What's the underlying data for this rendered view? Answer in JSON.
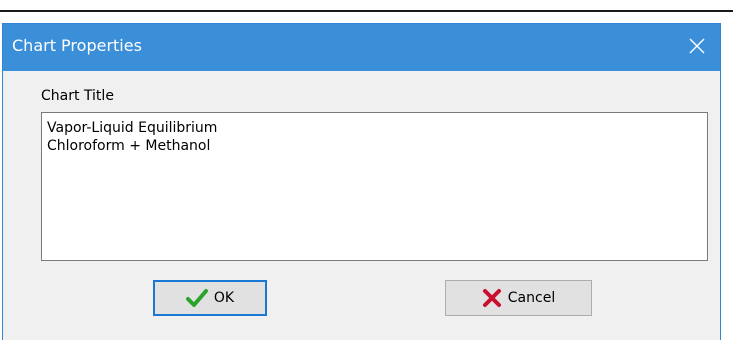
{
  "window": {
    "title": "Chart Properties",
    "close_icon": "close-icon",
    "titlebar_color": "#3b8fd8"
  },
  "form": {
    "chart_title_label": "Chart Title",
    "chart_title_value": "Vapor-Liquid Equilibrium\nChloroform + Methanol"
  },
  "buttons": {
    "ok_label": "OK",
    "ok_icon": "checkmark-icon",
    "ok_icon_color": "#2aa32a",
    "cancel_label": "Cancel",
    "cancel_icon": "x-mark-icon",
    "cancel_icon_color": "#c8102e"
  }
}
